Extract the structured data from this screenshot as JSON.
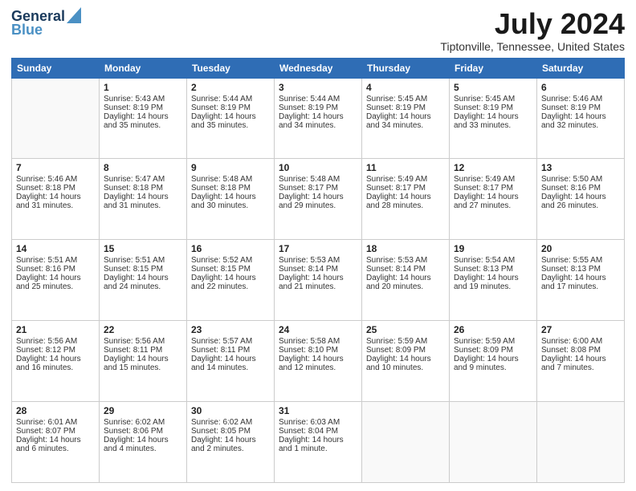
{
  "header": {
    "logo_line1": "General",
    "logo_line2": "Blue",
    "title": "July 2024",
    "location": "Tiptonville, Tennessee, United States"
  },
  "days_of_week": [
    "Sunday",
    "Monday",
    "Tuesday",
    "Wednesday",
    "Thursday",
    "Friday",
    "Saturday"
  ],
  "weeks": [
    [
      {
        "day": "",
        "info": ""
      },
      {
        "day": "1",
        "info": "Sunrise: 5:43 AM\nSunset: 8:19 PM\nDaylight: 14 hours\nand 35 minutes."
      },
      {
        "day": "2",
        "info": "Sunrise: 5:44 AM\nSunset: 8:19 PM\nDaylight: 14 hours\nand 35 minutes."
      },
      {
        "day": "3",
        "info": "Sunrise: 5:44 AM\nSunset: 8:19 PM\nDaylight: 14 hours\nand 34 minutes."
      },
      {
        "day": "4",
        "info": "Sunrise: 5:45 AM\nSunset: 8:19 PM\nDaylight: 14 hours\nand 34 minutes."
      },
      {
        "day": "5",
        "info": "Sunrise: 5:45 AM\nSunset: 8:19 PM\nDaylight: 14 hours\nand 33 minutes."
      },
      {
        "day": "6",
        "info": "Sunrise: 5:46 AM\nSunset: 8:19 PM\nDaylight: 14 hours\nand 32 minutes."
      }
    ],
    [
      {
        "day": "7",
        "info": "Sunrise: 5:46 AM\nSunset: 8:18 PM\nDaylight: 14 hours\nand 31 minutes."
      },
      {
        "day": "8",
        "info": "Sunrise: 5:47 AM\nSunset: 8:18 PM\nDaylight: 14 hours\nand 31 minutes."
      },
      {
        "day": "9",
        "info": "Sunrise: 5:48 AM\nSunset: 8:18 PM\nDaylight: 14 hours\nand 30 minutes."
      },
      {
        "day": "10",
        "info": "Sunrise: 5:48 AM\nSunset: 8:17 PM\nDaylight: 14 hours\nand 29 minutes."
      },
      {
        "day": "11",
        "info": "Sunrise: 5:49 AM\nSunset: 8:17 PM\nDaylight: 14 hours\nand 28 minutes."
      },
      {
        "day": "12",
        "info": "Sunrise: 5:49 AM\nSunset: 8:17 PM\nDaylight: 14 hours\nand 27 minutes."
      },
      {
        "day": "13",
        "info": "Sunrise: 5:50 AM\nSunset: 8:16 PM\nDaylight: 14 hours\nand 26 minutes."
      }
    ],
    [
      {
        "day": "14",
        "info": "Sunrise: 5:51 AM\nSunset: 8:16 PM\nDaylight: 14 hours\nand 25 minutes."
      },
      {
        "day": "15",
        "info": "Sunrise: 5:51 AM\nSunset: 8:15 PM\nDaylight: 14 hours\nand 24 minutes."
      },
      {
        "day": "16",
        "info": "Sunrise: 5:52 AM\nSunset: 8:15 PM\nDaylight: 14 hours\nand 22 minutes."
      },
      {
        "day": "17",
        "info": "Sunrise: 5:53 AM\nSunset: 8:14 PM\nDaylight: 14 hours\nand 21 minutes."
      },
      {
        "day": "18",
        "info": "Sunrise: 5:53 AM\nSunset: 8:14 PM\nDaylight: 14 hours\nand 20 minutes."
      },
      {
        "day": "19",
        "info": "Sunrise: 5:54 AM\nSunset: 8:13 PM\nDaylight: 14 hours\nand 19 minutes."
      },
      {
        "day": "20",
        "info": "Sunrise: 5:55 AM\nSunset: 8:13 PM\nDaylight: 14 hours\nand 17 minutes."
      }
    ],
    [
      {
        "day": "21",
        "info": "Sunrise: 5:56 AM\nSunset: 8:12 PM\nDaylight: 14 hours\nand 16 minutes."
      },
      {
        "day": "22",
        "info": "Sunrise: 5:56 AM\nSunset: 8:11 PM\nDaylight: 14 hours\nand 15 minutes."
      },
      {
        "day": "23",
        "info": "Sunrise: 5:57 AM\nSunset: 8:11 PM\nDaylight: 14 hours\nand 14 minutes."
      },
      {
        "day": "24",
        "info": "Sunrise: 5:58 AM\nSunset: 8:10 PM\nDaylight: 14 hours\nand 12 minutes."
      },
      {
        "day": "25",
        "info": "Sunrise: 5:59 AM\nSunset: 8:09 PM\nDaylight: 14 hours\nand 10 minutes."
      },
      {
        "day": "26",
        "info": "Sunrise: 5:59 AM\nSunset: 8:09 PM\nDaylight: 14 hours\nand 9 minutes."
      },
      {
        "day": "27",
        "info": "Sunrise: 6:00 AM\nSunset: 8:08 PM\nDaylight: 14 hours\nand 7 minutes."
      }
    ],
    [
      {
        "day": "28",
        "info": "Sunrise: 6:01 AM\nSunset: 8:07 PM\nDaylight: 14 hours\nand 6 minutes."
      },
      {
        "day": "29",
        "info": "Sunrise: 6:02 AM\nSunset: 8:06 PM\nDaylight: 14 hours\nand 4 minutes."
      },
      {
        "day": "30",
        "info": "Sunrise: 6:02 AM\nSunset: 8:05 PM\nDaylight: 14 hours\nand 2 minutes."
      },
      {
        "day": "31",
        "info": "Sunrise: 6:03 AM\nSunset: 8:04 PM\nDaylight: 14 hours\nand 1 minute."
      },
      {
        "day": "",
        "info": ""
      },
      {
        "day": "",
        "info": ""
      },
      {
        "day": "",
        "info": ""
      }
    ]
  ]
}
